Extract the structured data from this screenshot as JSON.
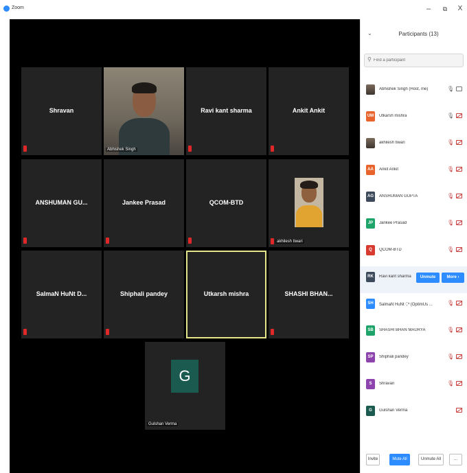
{
  "window": {
    "title": "Zoom",
    "minimize": "–",
    "maximize": "⧉",
    "close": "X"
  },
  "gallery": {
    "tiles": [
      {
        "name": "Shravan"
      },
      {
        "name": "",
        "label": "Abhishek Singh"
      },
      {
        "name": "Ravi kant sharma"
      },
      {
        "name": "Ankit Ankit"
      },
      {
        "name": "ANSHUMAN GU..."
      },
      {
        "name": "Jankee Prasad"
      },
      {
        "name": "QCOM-BTD"
      },
      {
        "name": "",
        "label": "akhilesh tiwari"
      },
      {
        "name": "SalmaN HuNt D..."
      },
      {
        "name": "Shiphali pandey"
      },
      {
        "name": "Utkarsh mishra"
      },
      {
        "name": "SHASHI BHAN..."
      },
      {
        "name": "",
        "label": "Gulshan Verma",
        "avatar": "G"
      }
    ]
  },
  "panel": {
    "title": "Participants (13)",
    "search_placeholder": "Find a participant",
    "participants": [
      {
        "initials": "",
        "name": "Abhishek Singh (Host, me)",
        "mic": "on",
        "cam": "on",
        "photo": true
      },
      {
        "initials": "UM",
        "name": "Utkarsh mishra",
        "mic": "on",
        "cam": "off",
        "color": "#E8642C"
      },
      {
        "initials": "",
        "name": "akhilesh tiwari",
        "mic": "off",
        "cam": "off",
        "photo": true
      },
      {
        "initials": "AA",
        "name": "Ankit Ankit",
        "mic": "off",
        "cam": "off",
        "color": "#E8642C"
      },
      {
        "initials": "AG",
        "name": "ANSHUMAN GUPTA",
        "mic": "off",
        "cam": "off",
        "color": "#3D4A5C"
      },
      {
        "initials": "JP",
        "name": "Jankee Prasad",
        "mic": "off",
        "cam": "off",
        "color": "#1EA46A"
      },
      {
        "initials": "Q",
        "name": "QCOM-BTD",
        "mic": "off",
        "cam": "off",
        "color": "#D73A2F"
      },
      {
        "initials": "RK",
        "name": "Ravi kant sharma",
        "color": "#3D4A5C",
        "hover": true
      },
      {
        "initials": "SH",
        "name": "SalmaN HuNt 🖓 (OptimUs ...",
        "mic": "off",
        "cam": "off",
        "color": "#2D8CFF"
      },
      {
        "initials": "SB",
        "name": "SHASHI BHAN MAURYA",
        "mic": "off",
        "cam": "off",
        "color": "#1EA46A"
      },
      {
        "initials": "SP",
        "name": "Shiphali pandey",
        "mic": "off",
        "cam": "off",
        "color": "#8E44AD"
      },
      {
        "initials": "S",
        "name": "Shravan",
        "mic": "off",
        "cam": "off",
        "color": "#8E44AD"
      },
      {
        "initials": "G",
        "name": "Gulshan Verma",
        "cam": "off",
        "color": "#1A5A4F"
      }
    ],
    "unmute_label": "Unmute",
    "more_label": "More ›",
    "footer": {
      "invite": "Invite",
      "mute_all": "Mute All",
      "unmute_all": "Unmute All",
      "more": "..."
    }
  },
  "colors": {
    "accent": "#2D8CFF",
    "muted_red": "#C83C3C",
    "active_border": "#E6E68A"
  }
}
